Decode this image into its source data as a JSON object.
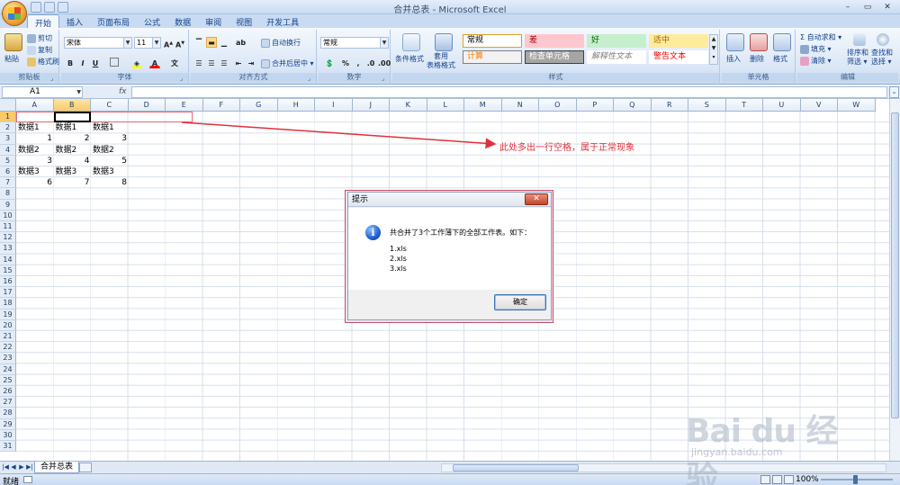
{
  "window": {
    "title": "合并总表 - Microsoft Excel",
    "controls": [
      "–",
      "▭",
      "✕"
    ]
  },
  "tabs": [
    "开始",
    "插入",
    "页面布局",
    "公式",
    "数据",
    "审阅",
    "视图",
    "开发工具"
  ],
  "ribbon": {
    "clipboard": {
      "label": "剪贴板",
      "paste": "粘贴",
      "cut": "剪切",
      "copy": "复制",
      "format_painter": "格式刷"
    },
    "font": {
      "label": "字体",
      "name": "宋体",
      "size": "11"
    },
    "alignment": {
      "label": "对齐方式",
      "wrap": "自动换行",
      "merge": "合并后居中 ▾"
    },
    "number": {
      "label": "数字",
      "format": "常规"
    },
    "styles": {
      "label": "样式",
      "cond_format": "条件格式",
      "table_format": "套用\n表格格式",
      "cells": [
        {
          "text": "常规",
          "bg": "#ffffff",
          "color": "#000000",
          "border": "#e0a020"
        },
        {
          "text": "差",
          "bg": "#ffc7ce",
          "color": "#9c0006",
          "border": "#ffc7ce"
        },
        {
          "text": "好",
          "bg": "#c6efce",
          "color": "#006100",
          "border": "#c6efce"
        },
        {
          "text": "适中",
          "bg": "#ffeb9c",
          "color": "#9c6500",
          "border": "#ffeb9c"
        },
        {
          "text": "计算",
          "bg": "#f2f2f2",
          "color": "#fa7d00",
          "border": "#7f7f7f"
        },
        {
          "text": "检查单元格",
          "bg": "#a5a5a5",
          "color": "#ffffff",
          "border": "#3f3f3f"
        },
        {
          "text": "解释性文本",
          "bg": "#ffffff",
          "color": "#7f7f7f",
          "border": "#ffffff"
        },
        {
          "text": "警告文本",
          "bg": "#ffffff",
          "color": "#ff0000",
          "border": "#ffffff"
        }
      ]
    },
    "cells_group": {
      "label": "单元格",
      "insert": "插入",
      "delete": "删除",
      "format": "格式"
    },
    "editing": {
      "label": "编辑",
      "autosum": "Σ 自动求和 ▾",
      "fill": "填充 ▾",
      "clear": "清除 ▾",
      "sort": "排序和\n筛选 ▾",
      "find": "查找和\n选择 ▾"
    }
  },
  "formula_bar": {
    "name_box": "A1",
    "fx": "fx",
    "value": ""
  },
  "columns": [
    "A",
    "B",
    "C",
    "D",
    "E",
    "F",
    "G",
    "H",
    "I",
    "J",
    "K",
    "L",
    "M",
    "N",
    "O",
    "P",
    "Q",
    "R",
    "S",
    "T",
    "U",
    "V",
    "W"
  ],
  "selected_column": "B",
  "rows": [
    "1",
    "2",
    "3",
    "4",
    "5",
    "6",
    "7",
    "8",
    "9",
    "10",
    "11",
    "12",
    "13",
    "14",
    "15",
    "16",
    "17",
    "18",
    "19",
    "20",
    "21",
    "22",
    "23",
    "24",
    "25",
    "26",
    "27",
    "28",
    "29",
    "30",
    "31"
  ],
  "cells": [
    {
      "row": 2,
      "col": 0,
      "text": "数据1",
      "num": false
    },
    {
      "row": 2,
      "col": 1,
      "text": "数据1",
      "num": false
    },
    {
      "row": 2,
      "col": 2,
      "text": "数据1",
      "num": false
    },
    {
      "row": 3,
      "col": 0,
      "text": "1",
      "num": true
    },
    {
      "row": 3,
      "col": 1,
      "text": "2",
      "num": true
    },
    {
      "row": 3,
      "col": 2,
      "text": "3",
      "num": true
    },
    {
      "row": 4,
      "col": 0,
      "text": "数据2",
      "num": false
    },
    {
      "row": 4,
      "col": 1,
      "text": "数据2",
      "num": false
    },
    {
      "row": 4,
      "col": 2,
      "text": "数据2",
      "num": false
    },
    {
      "row": 5,
      "col": 0,
      "text": "3",
      "num": true
    },
    {
      "row": 5,
      "col": 1,
      "text": "4",
      "num": true
    },
    {
      "row": 5,
      "col": 2,
      "text": "5",
      "num": true
    },
    {
      "row": 6,
      "col": 0,
      "text": "数据3",
      "num": false
    },
    {
      "row": 6,
      "col": 1,
      "text": "数据3",
      "num": false
    },
    {
      "row": 6,
      "col": 2,
      "text": "数据3",
      "num": false
    },
    {
      "row": 7,
      "col": 0,
      "text": "6",
      "num": true
    },
    {
      "row": 7,
      "col": 1,
      "text": "7",
      "num": true
    },
    {
      "row": 7,
      "col": 2,
      "text": "8",
      "num": true
    }
  ],
  "annotation": {
    "text": "此处多出一行空格，属于正常现象",
    "color": "#e0303a"
  },
  "dialog": {
    "title": "提示",
    "message": "共合并了3个工作薄下的全部工作表。如下：",
    "files": [
      "1.xls",
      "2.xls",
      "3.xls"
    ],
    "ok": "确定",
    "close": "✕"
  },
  "sheet_tab": "合并总表",
  "sheet_nav": [
    "|◀",
    "◀",
    "▶",
    "▶|"
  ],
  "status": {
    "ready": "就绪",
    "zoom": "100%"
  },
  "watermark": {
    "logo": "Bai du 经验",
    "url": "jingyan.baidu.com"
  }
}
